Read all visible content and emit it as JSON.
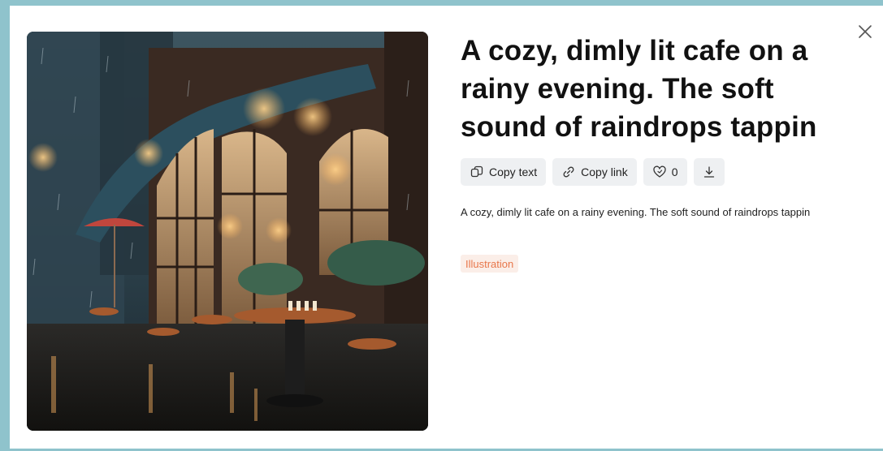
{
  "modal": {
    "title": "A cozy, dimly lit cafe on a rainy evening. The soft sound of raindrops tappin",
    "description": "A cozy, dimly lit cafe on a rainy evening. The soft sound of raindrops tappin",
    "close_icon": "close-icon"
  },
  "actions": {
    "copy_text_label": "Copy text",
    "copy_link_label": "Copy link",
    "like_count": "0",
    "icons": [
      "copy-icon",
      "link-icon",
      "heart-icon",
      "download-icon"
    ]
  },
  "tag": {
    "label": "Illustration",
    "color": "#e8764a"
  },
  "image": {
    "subject": "rainy-cafe-illustration"
  }
}
